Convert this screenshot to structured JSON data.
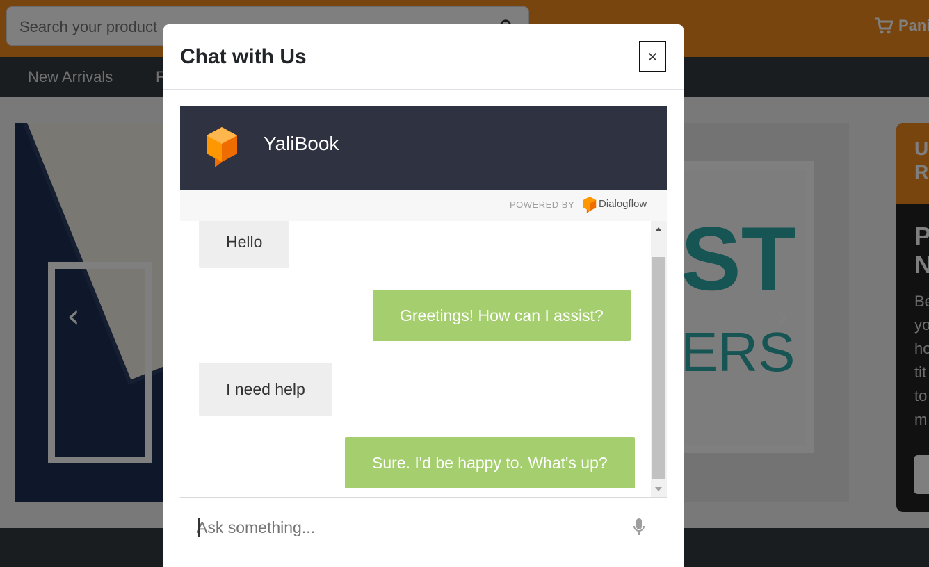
{
  "background": {
    "search": {
      "placeholder": "Search your product"
    },
    "cart": {
      "label": "Panier"
    },
    "nav": {
      "items": [
        {
          "label": "New Arrivals"
        },
        {
          "label": "F"
        }
      ]
    },
    "carousel": {
      "poster_line_1": "ST",
      "poster_line_2": "ERS"
    },
    "side_card": {
      "heading": "U\nR",
      "title": "P\nN",
      "body": "Be\nyo\nho\ntit\nto\nm"
    }
  },
  "modal": {
    "title": "Chat with Us",
    "close_label": "×"
  },
  "chat": {
    "agent_name": "YaliBook",
    "powered_by": "POWERED BY",
    "brand": "Dialogflow",
    "messages": [
      {
        "from": "user",
        "text": "Hello"
      },
      {
        "from": "bot",
        "text": "Greetings! How can I assist?"
      },
      {
        "from": "user",
        "text": "I need help"
      },
      {
        "from": "bot",
        "text": "Sure. I'd be happy to. What's up?"
      }
    ],
    "input": {
      "placeholder": "Ask something...",
      "value": ""
    }
  },
  "colors": {
    "brand_orange": "#f28a1d",
    "dialogflow_orange": "#ef6c00",
    "bot_bubble": "#a5cf6f",
    "user_bubble": "#eeeeee",
    "chat_header": "#2f3241"
  },
  "icons": {
    "search": "search-icon",
    "cart": "cart-icon",
    "close": "close-icon",
    "mic": "microphone-icon",
    "logo": "dialogflow-logo-icon"
  }
}
